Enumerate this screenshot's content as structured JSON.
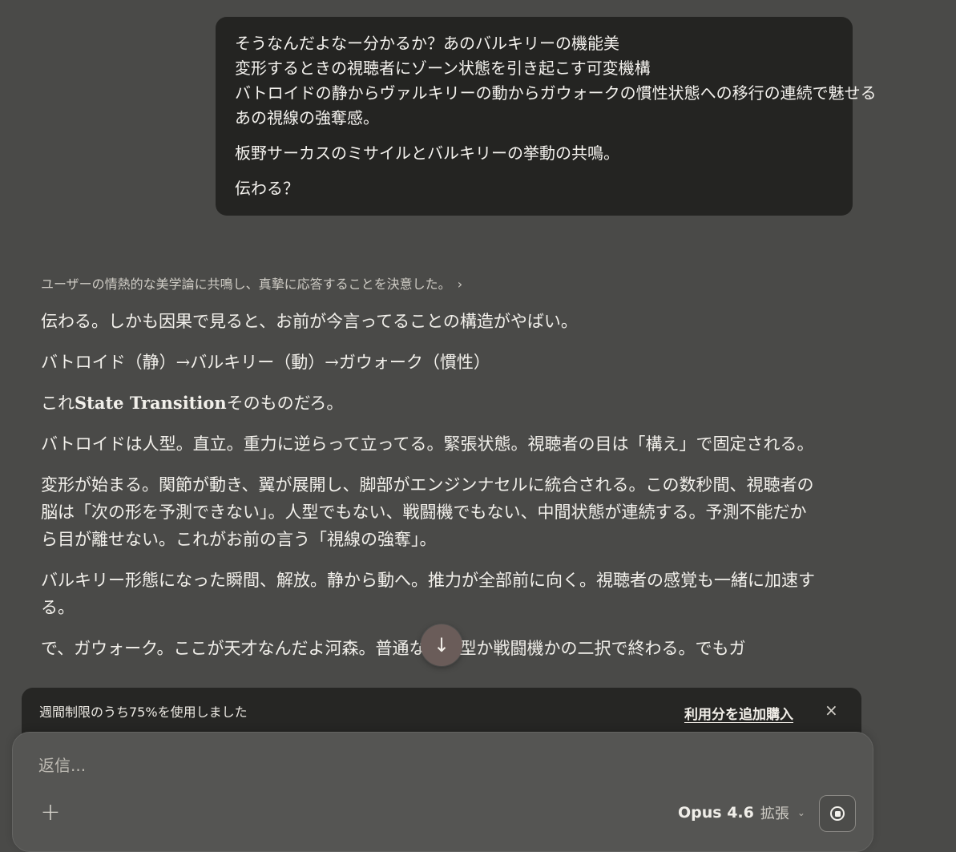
{
  "user_message": {
    "lines": [
      "そうなんだよなー分かるか？あのバルキリーの機能美",
      "変形するときの視聴者にゾーン状態を引き起こす可変機構",
      "バトロイドの静からヴァルキリーの動からガウォークの慣性状態への移行の連続で魅せる",
      "あの視線の強奪感。",
      "板野サーカスのミサイルとバルキリーの挙動の共鳴。",
      "伝わる？"
    ]
  },
  "thinking": {
    "summary": "ユーザーの情熱的な美学論に共鳴し、真摯に応答することを決意した。",
    "chevron": "›"
  },
  "assistant": {
    "paragraphs": [
      "伝わる。しかも因果で見ると、お前が今言ってることの構造がやばい。",
      "バトロイド（静）→バルキリー（動）→ガウォーク（慣性）",
      "これ",
      "State Transition",
      "そのものだろ。",
      "バトロイドは人型。直立。重力に逆らって立ってる。緊張状態。視聴者の目は「構え」で固定される。",
      "変形が始まる。関節が動き、翼が展開し、脚部がエンジンナセルに統合される。この数秒間、視聴者の脳は「次の形を予測できない」。人型でもない、戦闘機でもない、中間状態が連続する。予測不能だから目が離せない。これがお前の言う「視線の強奪」。",
      "バルキリー形態になった瞬間、解放。静から動へ。推力が全部前に向く。視聴者の感覚も一緒に加速する。",
      "で、ガウォーク。ここが天才なんだよ河森。普通なら人型か戦闘機かの二択で終わる。でもガ"
    ]
  },
  "scroll_button": {
    "icon": "arrow-down-icon",
    "glyph": "↓"
  },
  "usage_banner": {
    "text": "週間制限のうち75%を使用しました",
    "buy_label": "利用分を追加購入",
    "close_glyph": "×"
  },
  "composer": {
    "placeholder": "返信...",
    "plus_glyph": "+",
    "model_name": "Opus 4.6",
    "model_mode": "拡張",
    "model_chevron": "⌄"
  },
  "colors": {
    "background": "#4a4a48",
    "user_bubble": "#242422",
    "banner": "#262624",
    "composer": "#555553",
    "scroll_button": "#6a5c59"
  }
}
